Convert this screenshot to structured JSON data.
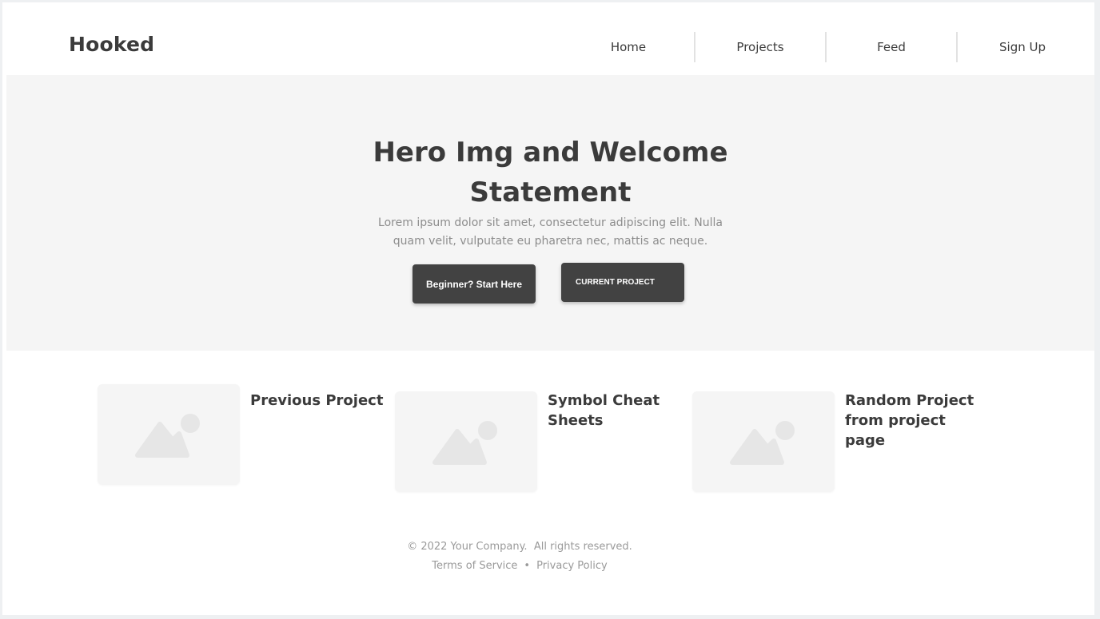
{
  "header": {
    "logo": "Hooked",
    "nav": [
      {
        "label": "Home"
      },
      {
        "label": "Projects"
      },
      {
        "label": "Feed"
      },
      {
        "label": "Sign Up"
      }
    ]
  },
  "hero": {
    "title_line1": "Hero Img and Welcome",
    "title_line2": "Statement",
    "text": "Lorem ipsum dolor sit amet, consectetur adipiscing elit. Nulla quam velit, vulputate eu pharetra nec, mattis ac neque.",
    "btn_start": "Beginner? Start Here",
    "btn_current": "CURRENT PROJECT"
  },
  "cards": [
    {
      "title": "Previous Project",
      "icon": "image-placeholder-icon"
    },
    {
      "title": "Symbol Cheat Sheets",
      "icon": "image-placeholder-icon"
    },
    {
      "title": "Random Project from project page",
      "icon": "image-placeholder-icon"
    }
  ],
  "footer": {
    "copyright": "© 2022 Your Company.  All rights reserved.",
    "terms": "Terms of Service",
    "separator": "•",
    "privacy": "Privacy Policy"
  },
  "colors": {
    "background": "#eef0f2",
    "hero_bg": "#f5f5f5",
    "button_bg": "#424242",
    "text_dark": "#3b3b3b",
    "text_muted": "#8d8d8d"
  }
}
